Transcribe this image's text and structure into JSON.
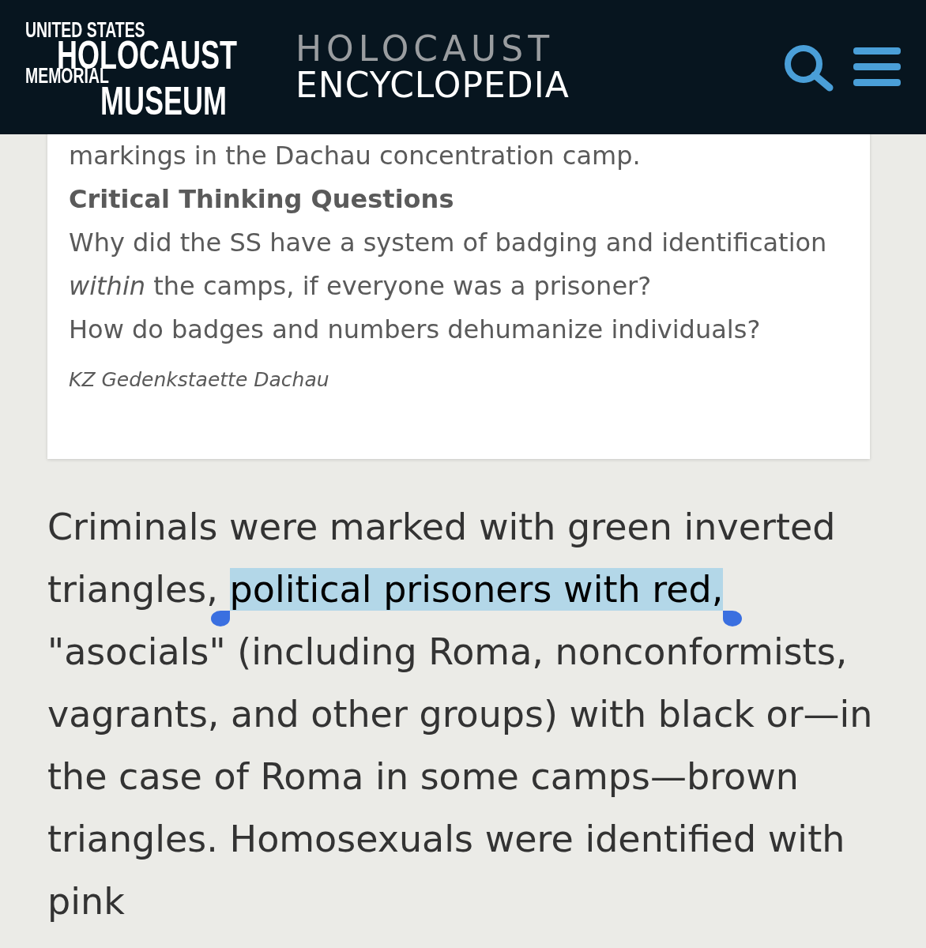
{
  "header": {
    "logo": [
      "UNITED STATES",
      "HOLOCAUST",
      "MEMORIAL",
      "MUSEUM"
    ],
    "title": [
      "HOLOCAUST",
      "ENCYCLOPEDIA"
    ]
  },
  "card": {
    "caption_tail": "markings in the Dachau concentration camp.",
    "heading": "Critical Thinking Questions",
    "questions": [
      "Why did the SS have a system of badging and identification *within* the camps, if everyone was a prisoner?",
      "How do badges and numbers dehumanize individuals?"
    ],
    "credit": "KZ Gedenkstaette Dachau"
  },
  "paragraph": [
    {
      "text": "Criminals were marked with green inverted triangles, ",
      "selected": false
    },
    {
      "text": "political prisoners with red,",
      "selected": true
    },
    {
      "text": " \"asocials\" (including Roma, nonconformists, vagrants, and other groups) with black or—in the case of Roma in some camps—brown triangles. Homosexuals were identified with pink",
      "selected": false
    }
  ]
}
